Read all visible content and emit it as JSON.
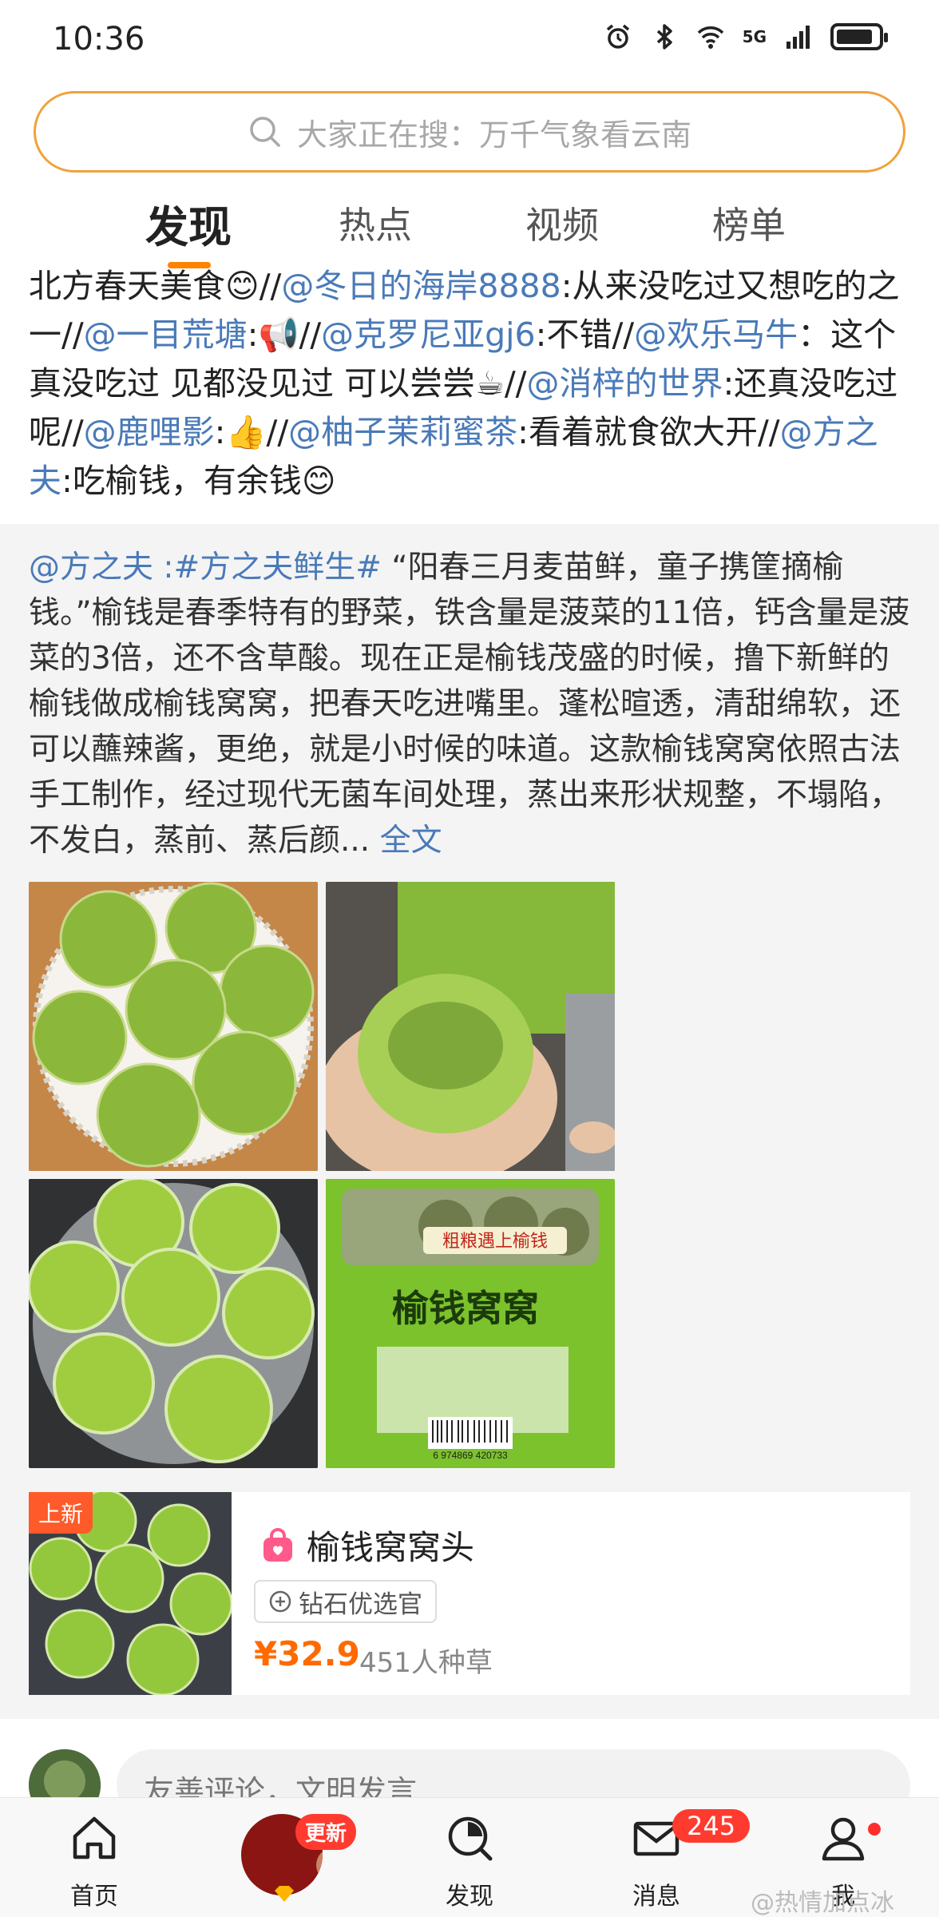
{
  "status_bar": {
    "time": "10:36",
    "network": "5G"
  },
  "search": {
    "placeholder": "大家正在搜：万千气象看云南"
  },
  "tabs": [
    {
      "label": "发现",
      "active": true
    },
    {
      "label": "热点",
      "active": false
    },
    {
      "label": "视频",
      "active": false
    },
    {
      "label": "榜单",
      "active": false
    }
  ],
  "repost": {
    "segments": [
      {
        "text": "北方春天美食😊//",
        "mention": false
      },
      {
        "text": "@冬日的海岸8888",
        "mention": true
      },
      {
        "text": ":从来没吃过又想吃的之一//",
        "mention": false
      },
      {
        "text": "@一目荒塘",
        "mention": true
      },
      {
        "text": ":📢//",
        "mention": false
      },
      {
        "text": "@克罗尼亚gj6",
        "mention": true
      },
      {
        "text": ":不错//",
        "mention": false
      },
      {
        "text": "@欢乐马牛",
        "mention": true
      },
      {
        "text": "：这个真没吃过 见都没见过 可以尝尝☕//",
        "mention": false
      },
      {
        "text": "@消梓的世界",
        "mention": true
      },
      {
        "text": ":还真没吃过呢//",
        "mention": false
      },
      {
        "text": "@鹿哩影",
        "mention": true
      },
      {
        "text": ":👍//",
        "mention": false
      },
      {
        "text": "@柚子茉莉蜜茶",
        "mention": true
      },
      {
        "text": ":看着就食欲大开//",
        "mention": false
      },
      {
        "text": "@方之夫",
        "mention": true
      },
      {
        "text": ":吃榆钱，有余钱😊",
        "mention": false
      }
    ]
  },
  "original_post": {
    "author": "@方之夫",
    "hashtag": " :#方之夫鲜生#",
    "body": " “阳春三月麦苗鲜，童子携筐摘榆钱。”榆钱是春季特有的野菜，铁含量是菠菜的11倍，钙含量是菠菜的3倍，还不含草酸。现在正是榆钱茂盛的时候，撸下新鲜的榆钱做成榆钱窝窝，把春天吃进嘴里。蓬松暄透，清甜绵软，还可以蘸辣酱，更绝，就是小时候的味道。这款榆钱窝窝依照古法手工制作，经过现代无菌车间处理，蒸出来形状规整，不塌陷，不发白，蒸前、蒸后颜...",
    "more_label": " 全文",
    "package_text": {
      "banner": "粗粮遇上榆钱",
      "name": "榆钱窝窝",
      "barcode": "6 974869 420733"
    }
  },
  "product": {
    "badge": "上新",
    "title": "榆钱窝窝头",
    "tag": "钻石优选官",
    "price": "¥32.9",
    "grass": "451人种草"
  },
  "comment": {
    "placeholder": "友善评论，文明发言"
  },
  "bottom_nav": {
    "home": "首页",
    "live_badge": "更新",
    "discover": "发现",
    "messages": "消息",
    "messages_badge": "245",
    "me": "我"
  },
  "watermark": "@热情加点冰",
  "colors": {
    "accent": "#ff8200",
    "mention": "#4a7ab8",
    "price": "#ff6a00",
    "badge": "#ff3b30"
  }
}
